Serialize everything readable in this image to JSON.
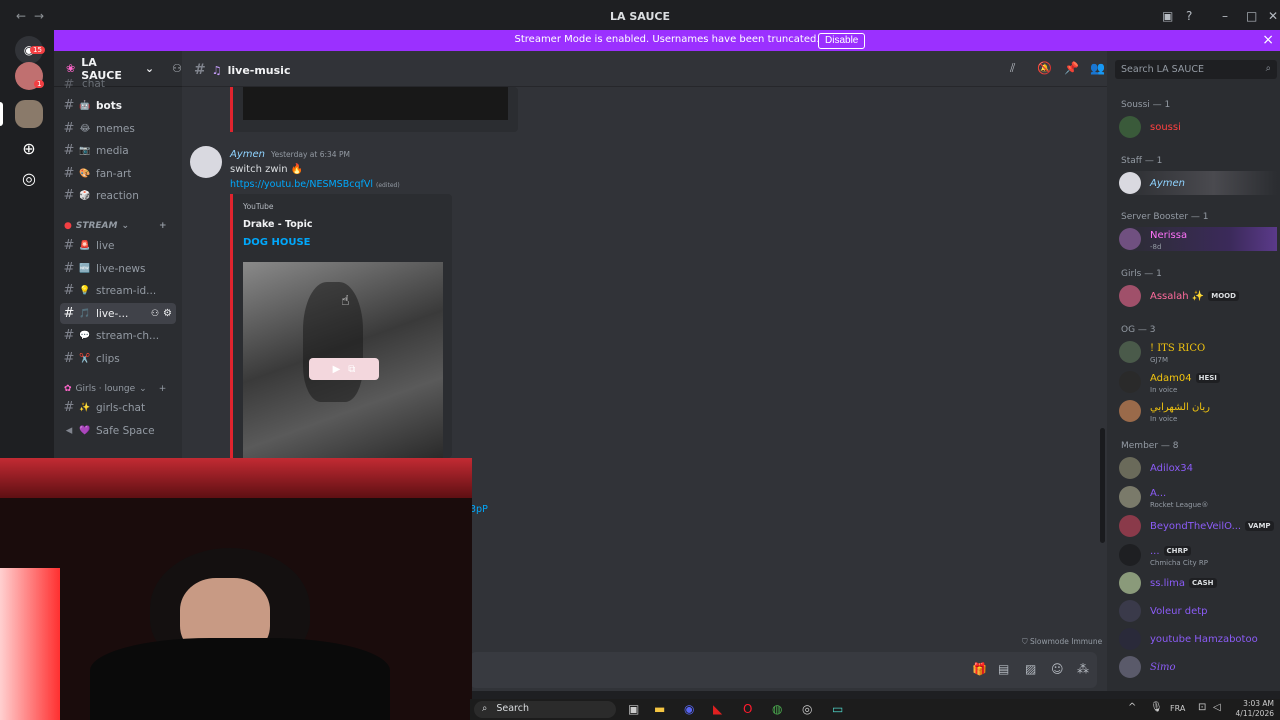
{
  "window": {
    "title": "LA SAUCE"
  },
  "banner": {
    "message": "Streamer Mode is enabled. Usernames have been truncated.",
    "button": "Disable"
  },
  "server": {
    "name": "LA SAUCE"
  },
  "rail": {
    "badge1": "15",
    "badge2": "1"
  },
  "channels": {
    "partial_top": "chat",
    "items": [
      {
        "emoji": "🤖",
        "label": "bots"
      },
      {
        "emoji": "😂",
        "label": "memes"
      },
      {
        "emoji": "📷",
        "label": "media"
      },
      {
        "emoji": "🎨",
        "label": "fan-art"
      },
      {
        "emoji": "🎲",
        "label": "reaction"
      }
    ],
    "stream_category": "STREAM",
    "stream_items": [
      {
        "emoji": "🚨",
        "label": "live"
      },
      {
        "emoji": "🆕",
        "label": "live-news"
      },
      {
        "emoji": "💡",
        "label": "stream-id..."
      },
      {
        "emoji": "🎵",
        "label": "live-..."
      },
      {
        "emoji": "💬",
        "label": "stream-ch..."
      },
      {
        "emoji": "✂️",
        "label": "clips"
      }
    ],
    "girls_category": "Girls ⋅ lounge",
    "girls_items": [
      {
        "emoji": "✨",
        "label": "girls-chat"
      },
      {
        "emoji": "💜",
        "label": "Safe Space"
      }
    ]
  },
  "chat_header": {
    "channel": "live-music"
  },
  "message": {
    "author": "Aymen",
    "time": "Yesterday at 6:34 PM",
    "text": "switch zwin",
    "link": "https://youtu.be/NESMSBcqfVl",
    "edited": "(edited)",
    "embed": {
      "provider": "YouTube",
      "author": "Drake - Topic",
      "title": "DOG HOUSE"
    },
    "partial_link": "3pP"
  },
  "search": {
    "placeholder": "Search LA SAUCE"
  },
  "slowmode": "Slowmode Immune",
  "members": {
    "groups": [
      {
        "title": "Soussi — 1",
        "members": [
          {
            "name": "soussi",
            "color": "#ff4040"
          }
        ]
      },
      {
        "title": "Staff — 1",
        "members": [
          {
            "name": "Aymen",
            "color": "#8fd3ff"
          }
        ]
      },
      {
        "title": "Server Booster — 1",
        "members": [
          {
            "name": "Nerissa",
            "color": "#ff73fa",
            "sub": "-8d"
          }
        ]
      },
      {
        "title": "Girls — 1",
        "members": [
          {
            "name": "Assalah ✨",
            "color": "#ff6b9d",
            "tag": "MOOD"
          }
        ]
      },
      {
        "title": "OG — 3",
        "members": [
          {
            "name": "! ITS RICO",
            "color": "#f1c40f",
            "sub": "GJ7M"
          },
          {
            "name": "Adam04",
            "color": "#f1c40f",
            "tag": "HESI",
            "sub": "In voice"
          },
          {
            "name": "ريان الشهرابي",
            "color": "#f1c40f",
            "sub": "In voice"
          }
        ]
      },
      {
        "title": "Member — 8",
        "members": [
          {
            "name": "Adilox34",
            "color": "#8b5cf6"
          },
          {
            "name": "A...",
            "color": "#8b5cf6",
            "sub": "Rocket League®"
          },
          {
            "name": "BeyondTheVeilO...",
            "color": "#8b5cf6",
            "tag": "VAMP"
          },
          {
            "name": "...",
            "color": "#8b5cf6",
            "tag": "CHRP",
            "sub": "Chmicha City RP"
          },
          {
            "name": "ss.lima",
            "color": "#8b5cf6",
            "tag": "CASH"
          },
          {
            "name": "Voleur detp",
            "color": "#8b5cf6"
          },
          {
            "name": "youtube Hamzabotoo",
            "color": "#8b5cf6"
          },
          {
            "name": "Simo",
            "color": "#8b5cf6"
          }
        ]
      }
    ]
  },
  "taskbar": {
    "search": "Search",
    "lang": "FRA",
    "time": "3:03 AM",
    "date": "4/11/2026"
  }
}
